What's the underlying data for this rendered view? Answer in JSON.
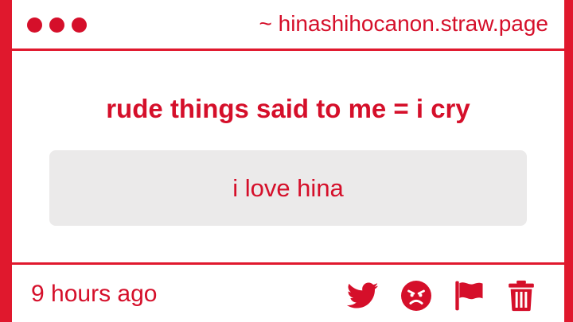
{
  "header": {
    "site": "~ hinashihocanon.straw.page"
  },
  "post": {
    "question": "rude things said to me = i cry",
    "answer": "i love hina",
    "time": "9 hours ago"
  },
  "actions": {
    "icons": [
      "twitter-icon",
      "angry-face-icon",
      "flag-icon",
      "trash-icon"
    ]
  },
  "colors": {
    "accent": "#e0182d",
    "text": "#d50f2a",
    "answer_bg": "#ebeaea",
    "card_bg": "#ffffff"
  }
}
